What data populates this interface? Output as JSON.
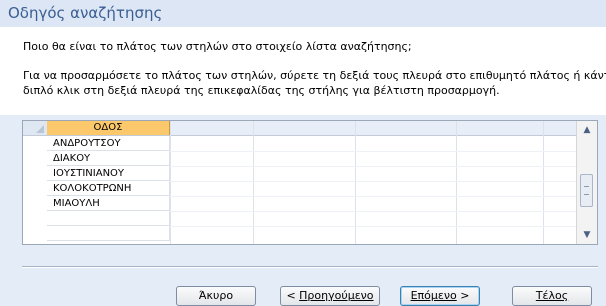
{
  "dialog": {
    "title": "Οδηγός αναζήτησης",
    "question": "Ποιο θα είναι το πλάτος των στηλών στο στοιχείο λίστα αναζήτησης;",
    "instruction_line1": "Για να προσαρμόσετε το πλάτος των στηλών, σύρετε τη δεξιά τους πλευρά στο επιθυμητό πλάτος ή κάντε",
    "instruction_line2": "διπλό κλικ στη δεξιά πλευρά της επικεφαλίδας της στήλης για βέλτιστη προσαρμογή."
  },
  "grid": {
    "column_header": "ΟΔΟΣ",
    "rows": [
      "ΑΝΔΡΟΥΤΣΟΥ",
      "ΔΙΑΚΟΥ",
      "ΙΟΥΣΤΙΝΙΑΝΟΥ",
      "ΚΟΛΟΚΟΤΡΩΝΗ",
      "ΜΙΑΟΥΛΗ",
      "",
      ""
    ]
  },
  "buttons": {
    "cancel": "Άκυρο",
    "back_prefix": "< ",
    "back_label": "Προηγούμενο",
    "next_label": "Επόμενο",
    "next_suffix": " >",
    "finish_label": "Τέλος"
  },
  "colors": {
    "accent": "#3a5e93",
    "column_header_bg": "#fbc96b"
  },
  "icons": {
    "scroll_up": "▲",
    "scroll_down": "▼"
  }
}
